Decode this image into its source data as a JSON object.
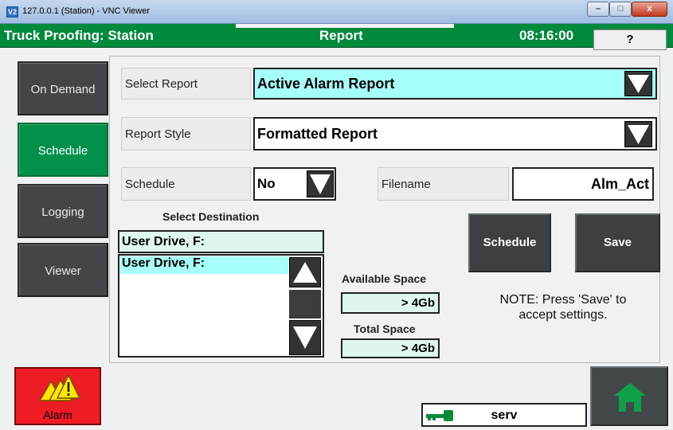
{
  "window": {
    "icon_text": "V2",
    "title": "127.0.0.1 (Station) - VNC Viewer",
    "controls": {
      "minimize": "–",
      "maximize": "□",
      "close": "x"
    }
  },
  "header": {
    "app_title": "Truck Proofing: Station",
    "screen_title": "Report",
    "clock": "08:16:00",
    "help_label": "?"
  },
  "nav": {
    "items": [
      {
        "label": "On Demand"
      },
      {
        "label": "Schedule",
        "active": true
      },
      {
        "label": "Logging"
      },
      {
        "label": "Viewer"
      }
    ]
  },
  "form": {
    "select_report": {
      "label": "Select Report",
      "value": "Active Alarm Report"
    },
    "report_style": {
      "label": "Report Style",
      "value": "Formatted Report"
    },
    "schedule": {
      "label": "Schedule",
      "value": "No"
    },
    "filename": {
      "label": "Filename",
      "value": "Alm_Act"
    }
  },
  "destination": {
    "heading": "Select Destination",
    "selected": "User Drive, F:",
    "list_items": [
      "User Drive, F:"
    ]
  },
  "space": {
    "available_label": "Available Space",
    "available_value": "> 4Gb",
    "total_label": "Total Space",
    "total_value": "> 4Gb"
  },
  "actions": {
    "schedule_label": "Schedule",
    "save_label": "Save"
  },
  "note": {
    "line1": "NOTE: Press 'Save' to",
    "line2": "accept settings."
  },
  "footer": {
    "alarm_label": "Alarm",
    "user": "serv"
  },
  "colors": {
    "header_green": "#008a3c",
    "active_nav": "#00904a",
    "field_cyan": "#a6fff8",
    "alarm_red": "#ee1c25",
    "home_green": "#0ea14a"
  }
}
